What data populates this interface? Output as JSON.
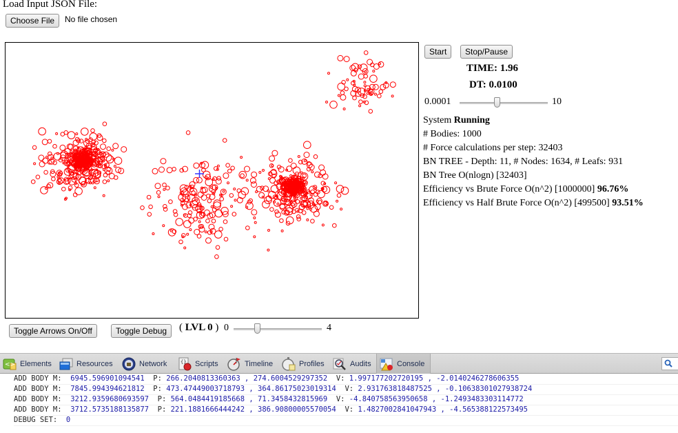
{
  "file_input": {
    "label": "Load Input JSON File:",
    "button": "Choose File",
    "status": "No file chosen"
  },
  "controls": {
    "start": "Start",
    "stop": "Stop/Pause",
    "time": "TIME: 1.96",
    "dt": "DT: 0.0100",
    "dt_slider": {
      "min_label": "0.0001",
      "max_label": "10",
      "position_fraction": 0.42
    }
  },
  "stats": {
    "system_prefix": "System ",
    "system_state": "Running",
    "bodies": "# Bodies: 1000",
    "force_calcs": "# Force calculations per step: 32403",
    "bn_tree": "BN TREE - Depth: 11, # Nodes: 1634, # Leafs: 931",
    "bn_complexity": "BN Tree O(nlogn) [32403]",
    "eff_brute_prefix": "Efficiency vs Brute Force O(n^2) [1000000] ",
    "eff_brute_value": "96.76%",
    "eff_half_prefix": "Efficiency vs Half Brute Force O(n^2) [499500] ",
    "eff_half_value": "93.51%"
  },
  "canvas": {
    "body_color": "#ff0000",
    "center_marker_color": "#3333ff",
    "body_count": 1000
  },
  "bottom_controls": {
    "toggle_arrows": "Toggle Arrows On/Off",
    "toggle_debug": "Toggle Debug",
    "lvl_open": "( ",
    "lvl_text": "LVL 0",
    "lvl_close": " )",
    "lvl_min": "0",
    "lvl_max": "4",
    "lvl_slider_fraction": 0.25
  },
  "devtools": {
    "tabs": [
      {
        "label": "Elements",
        "icon": "elements-icon"
      },
      {
        "label": "Resources",
        "icon": "resources-icon"
      },
      {
        "label": "Network",
        "icon": "network-icon"
      },
      {
        "label": "Scripts",
        "icon": "scripts-icon"
      },
      {
        "label": "Timeline",
        "icon": "timeline-icon"
      },
      {
        "label": "Profiles",
        "icon": "profiles-icon"
      },
      {
        "label": "Audits",
        "icon": "audits-icon"
      },
      {
        "label": "Console",
        "icon": "console-icon",
        "active": true
      }
    ],
    "search_icon": "search-icon"
  },
  "console": {
    "lines": [
      {
        "k1": "ADD BODY M:  ",
        "m": "6945.596901094541",
        "k2": "  P: ",
        "p": "266.2040813360363 , 274.6004529297352",
        "k3": "  V: ",
        "v": "1.997177202720195 , -2.0140246278606355"
      },
      {
        "k1": "ADD BODY M:  ",
        "m": "7845.994394621812",
        "k2": "  P: ",
        "p": "473.47449003718793 , 364.86175023019314",
        "k3": "  V: ",
        "v": "2.931763818487525 , -0.10638301027938724"
      },
      {
        "k1": "ADD BODY M:  ",
        "m": "3212.9359680693597",
        "k2": "  P: ",
        "p": "564.0484419185668 , 71.3458432815969",
        "k3": "  V: ",
        "v": "-4.840758563950658 , -1.2493483303114772"
      },
      {
        "k1": "ADD BODY M:  ",
        "m": "3712.5735188135877",
        "k2": "  P: ",
        "p": "221.1881666444242 , 386.90800005570054",
        "k3": "  V: ",
        "v": "1.4827002841047943 , -4.565388122573495"
      }
    ],
    "debug_key": "DEBUG SET:  ",
    "debug_value": "0"
  }
}
